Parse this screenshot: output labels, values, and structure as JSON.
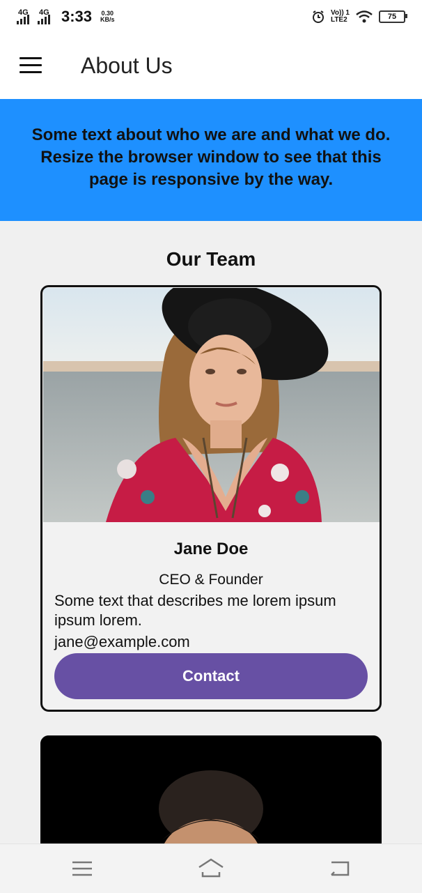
{
  "status_bar": {
    "signal1_label": "4G",
    "signal2_label": "4G",
    "time": "3:33",
    "speed_value": "0.30",
    "speed_unit": "KB/s",
    "volte_line1": "Vo)) 1",
    "volte_line2": "LTE2",
    "battery": "75"
  },
  "app_bar": {
    "title": "About Us"
  },
  "hero": {
    "text": "Some text about who we are and what we do. Resize the browser window to see that this page is responsive by the way.",
    "background": "#1e90ff"
  },
  "team": {
    "title": "Our Team",
    "members": [
      {
        "name": "Jane Doe",
        "role": "CEO & Founder",
        "description": "Some text that describes me lorem ipsum ipsum lorem.",
        "email": "jane@example.com",
        "contact_label": "Contact"
      }
    ]
  },
  "colors": {
    "accent": "#6750a4",
    "banner": "#1e90ff"
  },
  "nav": {
    "icons": [
      "menu-icon",
      "home-icon",
      "back-icon"
    ]
  }
}
